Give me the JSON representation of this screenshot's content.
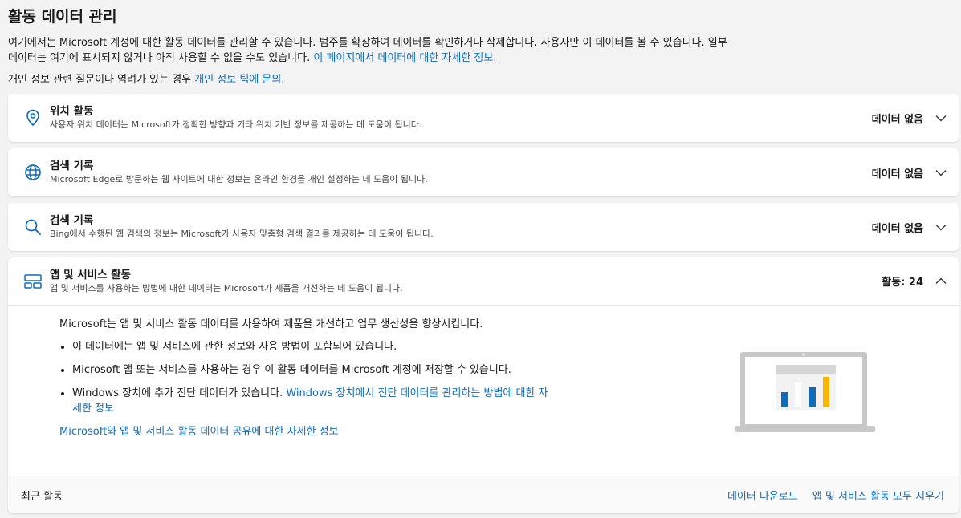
{
  "header": {
    "title": "활동 데이터 관리",
    "intro_text": "여기에서는 Microsoft 계정에 대한 활동 데이터를 관리할 수 있습니다. 범주를 확장하여 데이터를 확인하거나 삭제합니다. 사용자만 이 데이터를 볼 수 있습니다. 일부 데이터는 여기에 표시되지 않거나 아직 사용할 수 없을 수도 있습니다. ",
    "intro_link": "이 페이지에서 데이터에 대한 자세한 정보",
    "intro_period": ".",
    "privacy_text": "개인 정보 관련 질문이나 염려가 있는 경우 ",
    "privacy_link": "개인 정보 팀에 문의",
    "privacy_period": "."
  },
  "cards": [
    {
      "title": "위치 활동",
      "desc": "사용자 위치 데이터는 Microsoft가 정확한 방향과 기타 위치 기반 정보를 제공하는 데 도움이 됩니다.",
      "status": "데이터 없음",
      "icon": "location-pin-icon"
    },
    {
      "title": "검색 기록",
      "desc": "Microsoft Edge로 방문하는 웹 사이트에 대한 정보는 온라인 환경을 개인 설정하는 데 도움이 됩니다.",
      "status": "데이터 없음",
      "icon": "globe-icon"
    },
    {
      "title": "검색 기록",
      "desc": "Bing에서 수행된 웹 검색의 정보는 Microsoft가 사용자 맞춤형 검색 결과를 제공하는 데 도움이 됩니다.",
      "status": "데이터 없음",
      "icon": "search-icon"
    },
    {
      "title": "앱 및 서비스 활동",
      "desc": "앱 및 서비스를 사용하는 방법에 대한 데이터는 Microsoft가 제품을 개선하는 데 도움이 됩니다.",
      "status": "활동: 24",
      "icon": "apps-icon"
    }
  ],
  "expanded": {
    "lead": "Microsoft는 앱 및 서비스 활동 데이터를 사용하여 제품을 개선하고 업무 생산성을 향상시킵니다.",
    "bullet1": "이 데이터에는 앱 및 서비스에 관한 정보와 사용 방법이 포함되어 있습니다.",
    "bullet2": "Microsoft 앱 또는 서비스를 사용하는 경우 이 활동 데이터를 Microsoft 계정에 저장할 수 있습니다.",
    "bullet3_text": "Windows 장치에 추가 진단 데이터가 있습니다. ",
    "bullet3_link": "Windows 장치에서 진단 데이터를 관리하는 방법에 대한 자세한 정보",
    "learn_more": "Microsoft와 앱 및 서비스 활동 데이터 공유에 대한 자세한 정보"
  },
  "recent": {
    "title": "최근 활동",
    "download": "데이터 다운로드",
    "clear_all": "앱 및 서비스 활동 모두 지우기"
  },
  "colors": {
    "accent": "#0f6cbd",
    "background": "#f3f3f3"
  }
}
